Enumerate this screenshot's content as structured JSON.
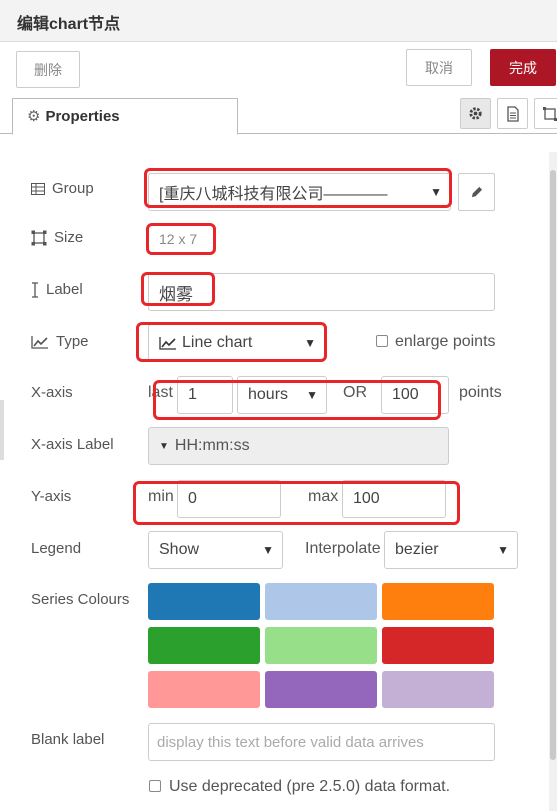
{
  "tray": {
    "title": "编辑chart节点"
  },
  "toolbar": {
    "delete_label": "删除",
    "cancel_label": "取消",
    "done_label": "完成"
  },
  "tabs": {
    "properties_label": "Properties"
  },
  "form": {
    "group": {
      "label": "Group",
      "value": "[重庆八城科技有限公司————"
    },
    "size": {
      "label": "Size",
      "value": "12 x 7"
    },
    "name_label": {
      "label": "Label",
      "value": "烟雾"
    },
    "type": {
      "label": "Type",
      "value": "Line chart",
      "enlarge_label": "enlarge points"
    },
    "xaxis": {
      "label": "X-axis",
      "last_text": "last",
      "last_value": "1",
      "unit": "hours",
      "or_text": "OR",
      "points_value": "100",
      "points_text": "points"
    },
    "xaxis_label": {
      "label": "X-axis Label",
      "value": "HH:mm:ss"
    },
    "yaxis": {
      "label": "Y-axis",
      "min_text": "min",
      "min_value": "0",
      "max_text": "max",
      "max_value": "100"
    },
    "legend": {
      "label": "Legend",
      "value": "Show",
      "interpolate_label": "Interpolate",
      "interpolate_value": "bezier"
    },
    "series_colours": {
      "label": "Series Colours",
      "colors": [
        "#1f77b4",
        "#aec7e8",
        "#ff7f0e",
        "#2ca02c",
        "#98df8a",
        "#d62728",
        "#ff9896",
        "#9467bd",
        "#c5b0d5"
      ]
    },
    "blank_label": {
      "label": "Blank label",
      "placeholder": "display this text before valid data arrives"
    },
    "deprecated": {
      "label": "Use deprecated (pre 2.5.0) data format."
    }
  }
}
